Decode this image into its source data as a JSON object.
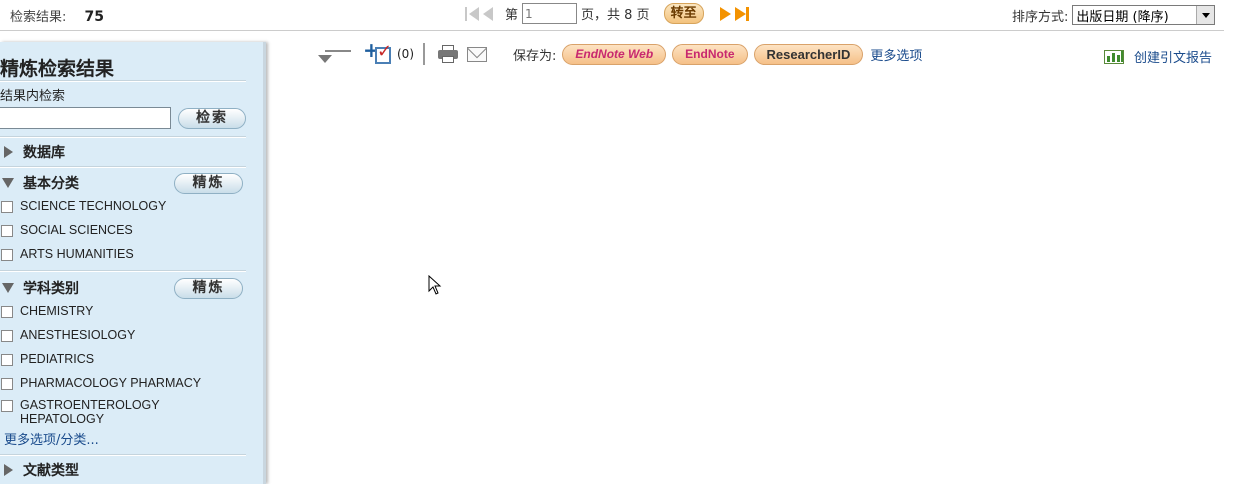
{
  "topbar": {
    "results_label": "检索结果:",
    "results_count": "75",
    "pager": {
      "page_prefix": "第",
      "page_value": "1",
      "page_suffix": "页，共 8 页",
      "go_label": "转至"
    },
    "sort": {
      "label": "排序方式:",
      "selected": "出版日期 (降序)"
    }
  },
  "sidebar": {
    "title": "精炼检索结果",
    "search_within_label": "结果内检索",
    "search_button": "检索",
    "sections": {
      "database": {
        "label": "数据库"
      },
      "basic_category": {
        "label": "基本分类",
        "refine_button": "精炼",
        "items": [
          "SCIENCE TECHNOLOGY",
          "SOCIAL SCIENCES",
          "ARTS HUMANITIES"
        ]
      },
      "subject_category": {
        "label": "学科类别",
        "refine_button": "精炼",
        "items": [
          "CHEMISTRY",
          "ANESTHESIOLOGY",
          "PEDIATRICS",
          "PHARMACOLOGY PHARMACY",
          "GASTROENTEROLOGY HEPATOLOGY"
        ],
        "more_link": "更多选项/分类..."
      },
      "doc_type": {
        "label": "文献类型"
      }
    }
  },
  "toolbar": {
    "marked_count": "(0)",
    "save_to_label": "保存为:",
    "endnote_web": "EndNote Web",
    "endnote": "EndNote",
    "researcher_id": "ResearcherID",
    "more_options": "更多选项"
  },
  "report": {
    "label": "创建引文报告"
  }
}
